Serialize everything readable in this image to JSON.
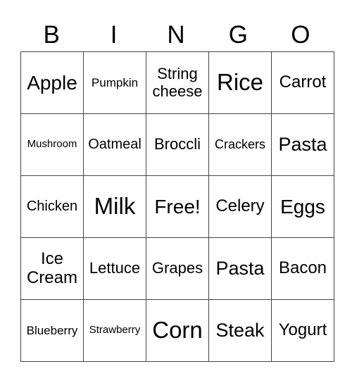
{
  "header": [
    "B",
    "I",
    "N",
    "G",
    "O"
  ],
  "grid": [
    [
      "Apple",
      "Pumpkin",
      "String cheese",
      "Rice",
      "Carrot"
    ],
    [
      "Mushroom",
      "Oatmeal",
      "Broccli",
      "Crackers",
      "Pasta"
    ],
    [
      "Chicken",
      "Milk",
      "Free!",
      "Celery",
      "Eggs"
    ],
    [
      "Ice Cream",
      "Lettuce",
      "Grapes",
      "Pasta",
      "Bacon"
    ],
    [
      "Blueberry",
      "Strawberry",
      "Corn",
      "Steak",
      "Yogurt"
    ]
  ]
}
